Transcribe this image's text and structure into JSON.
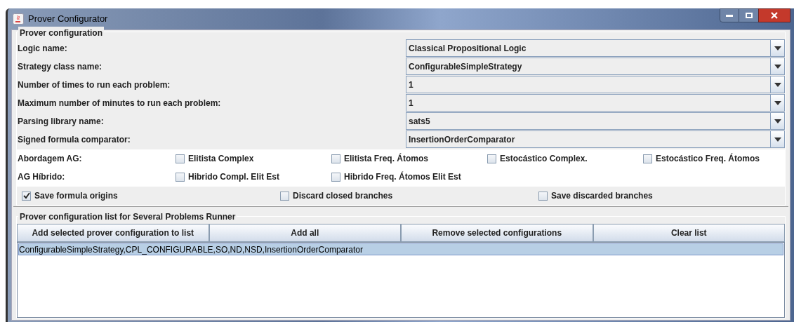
{
  "window": {
    "title": "Prover Configurator"
  },
  "prover_configuration": {
    "title": "Prover configuration",
    "fields": [
      {
        "label": "Logic name:",
        "value": "Classical Propositional Logic"
      },
      {
        "label": "Strategy class name:",
        "value": "ConfigurableSimpleStrategy"
      },
      {
        "label": "Number of times to run each problem:",
        "value": "1"
      },
      {
        "label": "Maximum number of minutes to run each problem:",
        "value": "1"
      },
      {
        "label": "Parsing library name:",
        "value": "sats5"
      },
      {
        "label": "Signed formula comparator:",
        "value": "InsertionOrderComparator"
      }
    ],
    "ag_rows": [
      {
        "label": "Abordagem AG:",
        "options": [
          {
            "label": "Elitista Complex",
            "checked": false
          },
          {
            "label": "Elitista Freq. Átomos",
            "checked": false
          },
          {
            "label": "Estocástico Complex.",
            "checked": false
          },
          {
            "label": "Estocástico Freq. Átomos",
            "checked": false
          }
        ]
      },
      {
        "label": "AG Híbrido:",
        "options": [
          {
            "label": "Hibrido Compl. Elit Est",
            "checked": false
          },
          {
            "label": "Hibrido Freq. Átomos Elit Est",
            "checked": false
          }
        ]
      }
    ],
    "options": [
      {
        "label": "Save formula origins",
        "checked": true
      },
      {
        "label": "Discard closed branches",
        "checked": false
      },
      {
        "label": "Save discarded branches",
        "checked": false
      }
    ]
  },
  "configuration_list": {
    "title": "Prover configuration list for Several Problems Runner",
    "buttons": [
      "Add selected prover configuration to list",
      "Add all",
      "Remove selected configurations",
      "Clear list"
    ],
    "items": [
      {
        "text": "ConfigurableSimpleStrategy,CPL_CONFIGURABLE,SO,ND,NSD,InsertionOrderComparator",
        "selected": true
      }
    ]
  }
}
